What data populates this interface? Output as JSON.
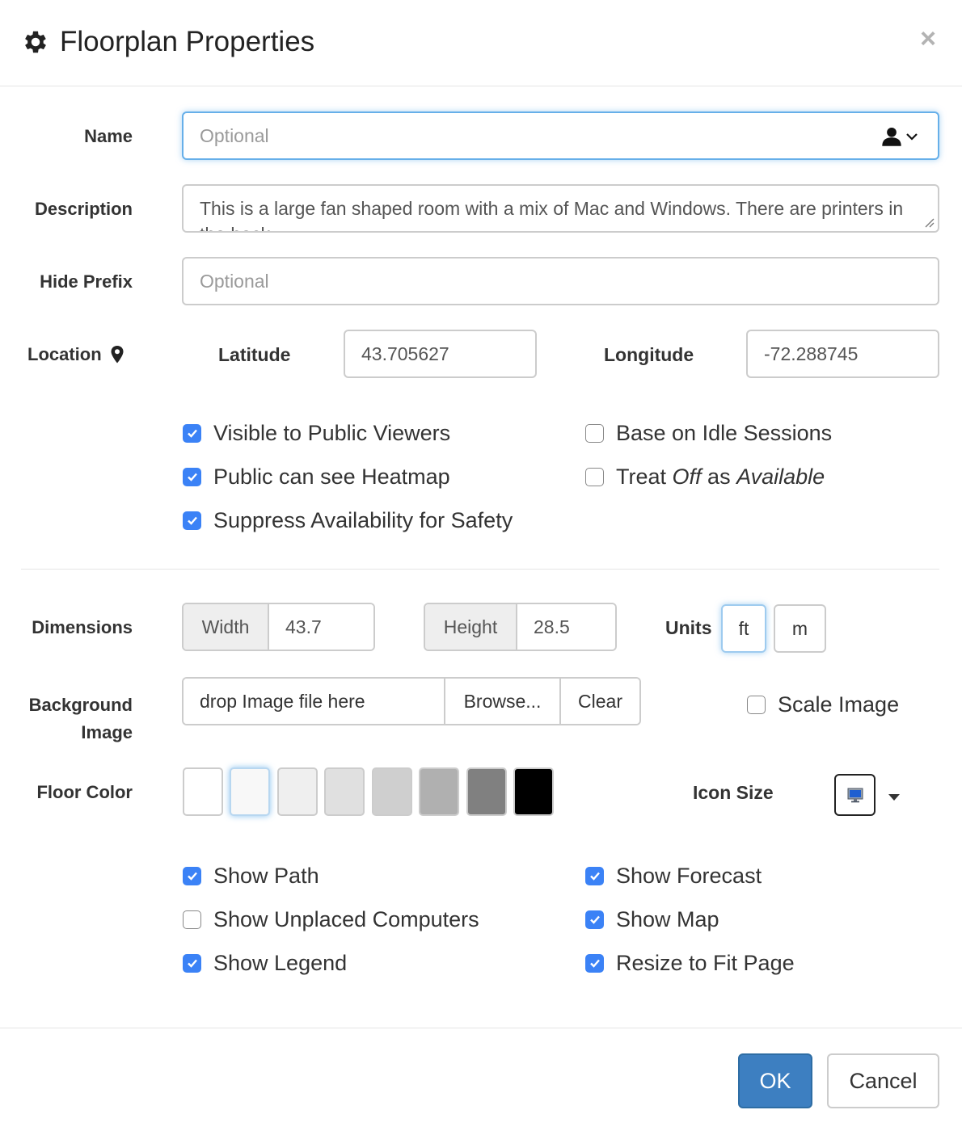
{
  "header": {
    "title": "Floorplan Properties",
    "icon": "gear-icon",
    "close": "×"
  },
  "name": {
    "label": "Name",
    "placeholder": "Optional",
    "value": ""
  },
  "description": {
    "label": "Description",
    "value": "This is a large fan shaped room with a mix of Mac and Windows. There are printers in the back."
  },
  "hide_prefix": {
    "label": "Hide Prefix",
    "placeholder": "Optional"
  },
  "location": {
    "label": "Location",
    "latitude_label": "Latitude",
    "latitude": "43.705627",
    "longitude_label": "Longitude",
    "longitude": "-72.288745"
  },
  "options": [
    {
      "label": "Visible to Public Viewers",
      "checked": true
    },
    {
      "label": "Public can see Heatmap",
      "checked": true
    },
    {
      "label": "Suppress Availability for Safety",
      "checked": true
    },
    {
      "label": "Base on Idle Sessions",
      "checked": false
    }
  ],
  "treat_off": {
    "pre": "Treat ",
    "em1": "Off",
    "mid": " as ",
    "em2": "Available",
    "checked": false
  },
  "dimensions": {
    "label": "Dimensions",
    "width_label": "Width",
    "width": "43.7",
    "height_label": "Height",
    "height": "28.5",
    "units_label": "Units",
    "unit_ft": "ft",
    "unit_m": "m",
    "selected_unit": "ft"
  },
  "background": {
    "label_line1": "Background",
    "label_line2": "Image",
    "drop_text": "drop Image file here",
    "browse": "Browse...",
    "clear": "Clear",
    "scale_label": "Scale Image",
    "scale_checked": false
  },
  "floor_color": {
    "label": "Floor Color",
    "swatches": [
      "#ffffff",
      "#f8f8f8",
      "#efefef",
      "#e0e0e0",
      "#cfcfcf",
      "#b0b0b0",
      "#808080",
      "#000000"
    ],
    "selected_index": 1
  },
  "icon_size": {
    "label": "Icon Size"
  },
  "display_options": [
    {
      "label": "Show Path",
      "checked": true
    },
    {
      "label": "Show Unplaced Computers",
      "checked": false
    },
    {
      "label": "Show Legend",
      "checked": true
    },
    {
      "label": "Show Forecast",
      "checked": true
    },
    {
      "label": "Show Map",
      "checked": true
    },
    {
      "label": "Resize to Fit Page",
      "checked": true
    }
  ],
  "footer": {
    "ok": "OK",
    "cancel": "Cancel"
  }
}
